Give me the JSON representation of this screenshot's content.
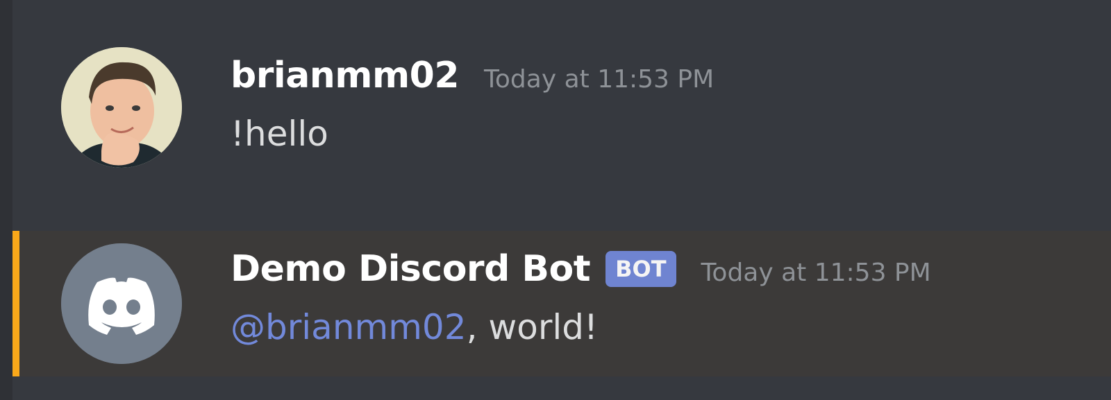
{
  "messages": [
    {
      "author": "brianmm02",
      "timestamp": "Today at 11:53 PM",
      "content": "!hello"
    },
    {
      "author": "Demo Discord Bot",
      "badge": "BOT",
      "timestamp": "Today at 11:53 PM",
      "mention": "@brianmm02",
      "content": ", world!"
    }
  ],
  "colors": {
    "background": "#36393f",
    "mention_highlight": "#3c3a39",
    "mention_bar": "#faa81a",
    "mention_text": "#7289da",
    "bot_badge": "#7289da"
  },
  "icons": {
    "user_avatar": "user-photo-avatar",
    "bot_avatar": "discord-logo-icon"
  }
}
